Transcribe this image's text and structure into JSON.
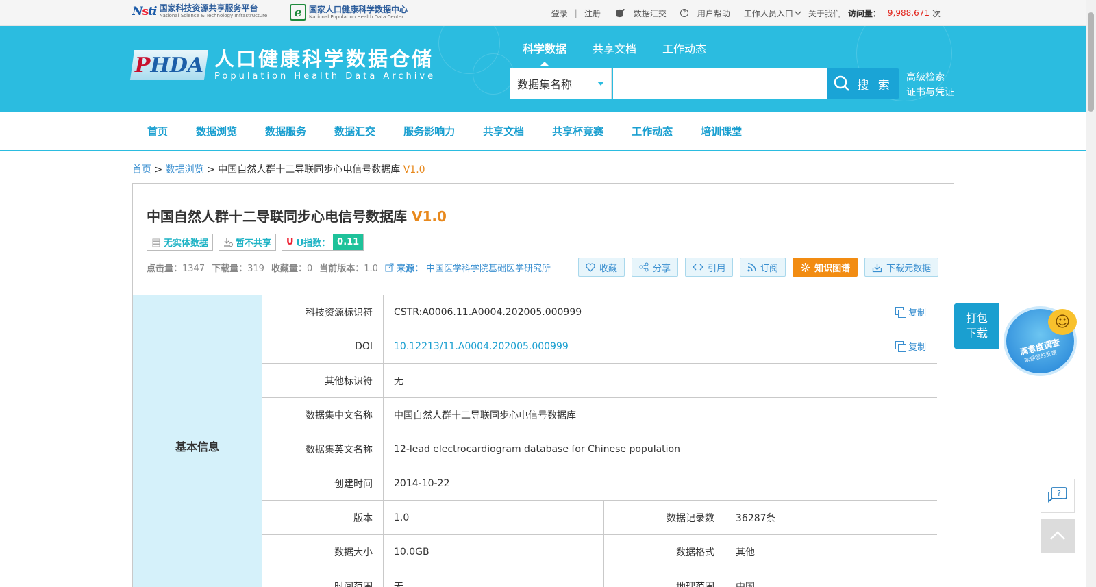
{
  "topbar": {
    "nsti_cn": "国家科技资源共享服务平台",
    "nsti_en": "National Science & Technology Infrastructure",
    "nphdc_cn": "国家人口健康科学数据中心",
    "nphdc_en": "National Population Health Data Center",
    "login": "登录",
    "register": "注册",
    "data_submit": "数据汇交",
    "user_help": "用户帮助",
    "staff_entry": "工作人员入口",
    "about": "关于我们",
    "visits_label": "访问量：",
    "visits_value": "9,988,671",
    "visits_unit": "次"
  },
  "banner": {
    "logo_text": "PHDA",
    "title_cn": "人口健康科学数据仓储",
    "title_en": "Population  Health  Data  Archive",
    "nav": [
      "科学数据",
      "共享文档",
      "工作动态"
    ],
    "search_scope": "数据集名称",
    "search_value": "",
    "search_button": "搜 索",
    "advanced_search": "高级检索",
    "certificates": "证书与凭证"
  },
  "mainnav": [
    "首页",
    "数据浏览",
    "数据服务",
    "数据汇交",
    "服务影响力",
    "共享文档",
    "共享杯竞赛",
    "工作动态",
    "培训课堂"
  ],
  "breadcrumb": {
    "home": "首页",
    "browse": "数据浏览",
    "sep": ">",
    "current": "中国自然人群十二导联同步心电信号数据库",
    "version": "V1.0"
  },
  "dataset": {
    "title": "中国自然人群十二导联同步心电信号数据库",
    "version": "V1.0",
    "tag_no_entity": "无实体数据",
    "tag_not_shared": "暂不共享",
    "u_index_label": "U指数：",
    "u_index_value": "0.11",
    "clicks_label": "点击量：",
    "clicks_value": "1347",
    "downloads_label": "下载量：",
    "downloads_value": "319",
    "favorites_label": "收藏量：",
    "favorites_value": "0",
    "current_version_label": "当前版本：",
    "current_version_value": "1.0",
    "source_label": "来源：",
    "source_value": "中国医学科学院基础医学研究所",
    "actions": {
      "favorite": "收藏",
      "share": "分享",
      "cite": "引用",
      "subscribe": "订阅",
      "knowledge_graph": "知识图谱",
      "download_meta": "下载元数据"
    }
  },
  "info": {
    "section_label": "基本信息",
    "copy_label": "复制",
    "cstr_key": "科技资源标识符",
    "cstr_value": "CSTR:A0006.11.A0004.202005.000999",
    "doi_key": "DOI",
    "doi_value": "10.12213/11.A0004.202005.000999",
    "other_id_key": "其他标识符",
    "other_id_value": "无",
    "cn_name_key": "数据集中文名称",
    "cn_name_value": "中国自然人群十二导联同步心电信号数据库",
    "en_name_key": "数据集英文名称",
    "en_name_value": "12-lead electrocardiogram database for Chinese population",
    "created_key": "创建时间",
    "created_value": "2014-10-22",
    "version_key": "版本",
    "version_value": "1.0",
    "records_key": "数据记录数",
    "records_value": "36287条",
    "size_key": "数据大小",
    "size_value": "10.0GB",
    "format_key": "数据格式",
    "format_value": "其他",
    "time_range_key": "时间范围",
    "time_range_value": "无",
    "geo_range_key": "地理范围",
    "geo_range_value": "中国"
  },
  "float": {
    "pack_line1": "打包",
    "pack_line2": "下载",
    "survey_title": "满意度调查",
    "survey_sub": "欢迎您的反馈"
  },
  "colors": {
    "accent": "#2bbce0",
    "link": "#1a9fd0",
    "orange": "#f28c12",
    "u_index_bg": "#1ec29a",
    "visit_red": "#e2231a"
  }
}
